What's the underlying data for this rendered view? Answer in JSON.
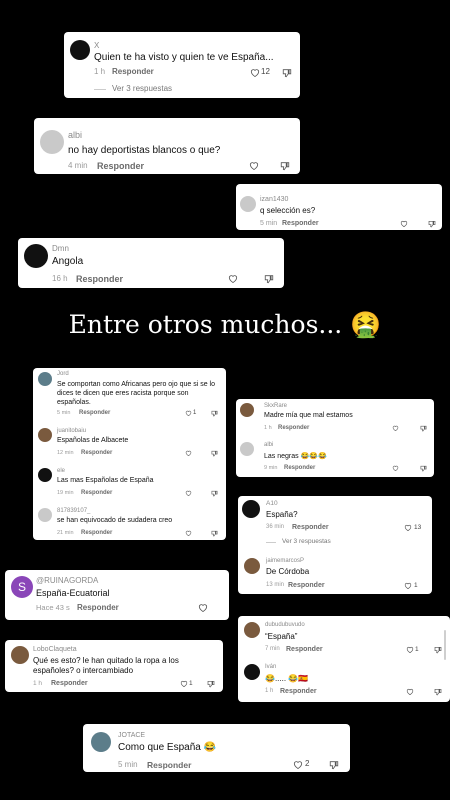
{
  "overlay": {
    "text": "Entre otros muchos...",
    "emoji": "🤮"
  },
  "comments": [
    {
      "user": "X",
      "text": "Quien te ha visto y quien te ve España...",
      "time": "1 h",
      "reply": "Responder",
      "likes": "12",
      "more": "Ver 3 respuestas"
    },
    {
      "user": "albi",
      "text": "no hay deportistas blancos o que?",
      "time": "4 min",
      "reply": "Responder"
    },
    {
      "user": "izan1430",
      "text": "q selección es?",
      "time": "5 min",
      "reply": "Responder"
    },
    {
      "user": "Dmn",
      "text": "Angola",
      "time": "16 h",
      "reply": "Responder"
    },
    {
      "user": "Jord",
      "text": "Se comportan como Africanas pero ojo que si se lo dices te dicen que eres racista porque son españolas.",
      "time": "5 min",
      "reply": "Responder",
      "likes": "1"
    },
    {
      "user": "juanitobaiu",
      "text": "Españolas de Albacete",
      "time": "12 min",
      "reply": "Responder"
    },
    {
      "user": "ele",
      "text": "Las mas Españolas de España",
      "time": "19 min",
      "reply": "Responder"
    },
    {
      "user": "817839107_",
      "text": "se han equivocado de sudadera creo",
      "time": "21 min",
      "reply": "Responder"
    },
    {
      "user": "SkxRare",
      "text": "Madre mía que mal estamos",
      "time": "1 h",
      "reply": "Responder"
    },
    {
      "user": "albi",
      "text": "Las negras 😂😂😂",
      "time": "9 min",
      "reply": "Responder"
    },
    {
      "user": "A10",
      "text": "España?",
      "time": "36 min",
      "reply": "Responder",
      "likes": "13",
      "more": "Ver 3 respuestas"
    },
    {
      "user": "jaimemarcosP",
      "text": "De Córdoba",
      "time": "13 min",
      "reply": "Responder",
      "likes": "1"
    },
    {
      "user": "@RUINAGORDA",
      "text": "España-Ecuatorial",
      "time": "Hace 43 s",
      "reply": "Responder",
      "avatar": "S"
    },
    {
      "user": "dubudubuvudo",
      "text": "“España”",
      "time": "7 min",
      "reply": "Responder",
      "likes": "1"
    },
    {
      "user": "Iván",
      "text": "😂..... 😂🇪🇸",
      "time": "1 h",
      "reply": "Responder"
    },
    {
      "user": "LoboClaqueta",
      "text": "Qué es esto? le han quitado la ropa a los españoles? o intercambiado",
      "time": "1 h",
      "reply": "Responder",
      "likes": "1"
    },
    {
      "user": "JOTACE",
      "text": "Como que España 😂",
      "time": "5 min",
      "reply": "Responder",
      "likes": "2"
    }
  ]
}
